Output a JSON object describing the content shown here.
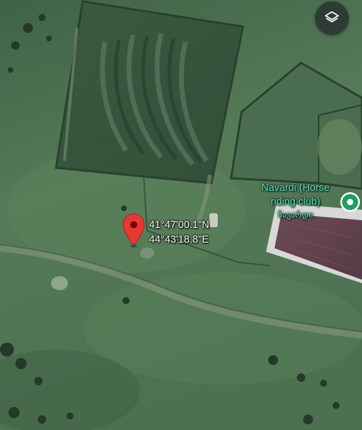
{
  "map": {
    "type": "satellite"
  },
  "controls": {
    "layers_icon": "layers-icon"
  },
  "dropped_pin": {
    "latitude": "41°47'00.1\"N",
    "longitude": "44°43'18.8\"E",
    "color": "#e53935"
  },
  "place": {
    "name": "Navardi (Horse riding club)",
    "native_name": "ნავარდი",
    "label_color": "#5fe0a0",
    "marker_color": "#1e9e63"
  }
}
